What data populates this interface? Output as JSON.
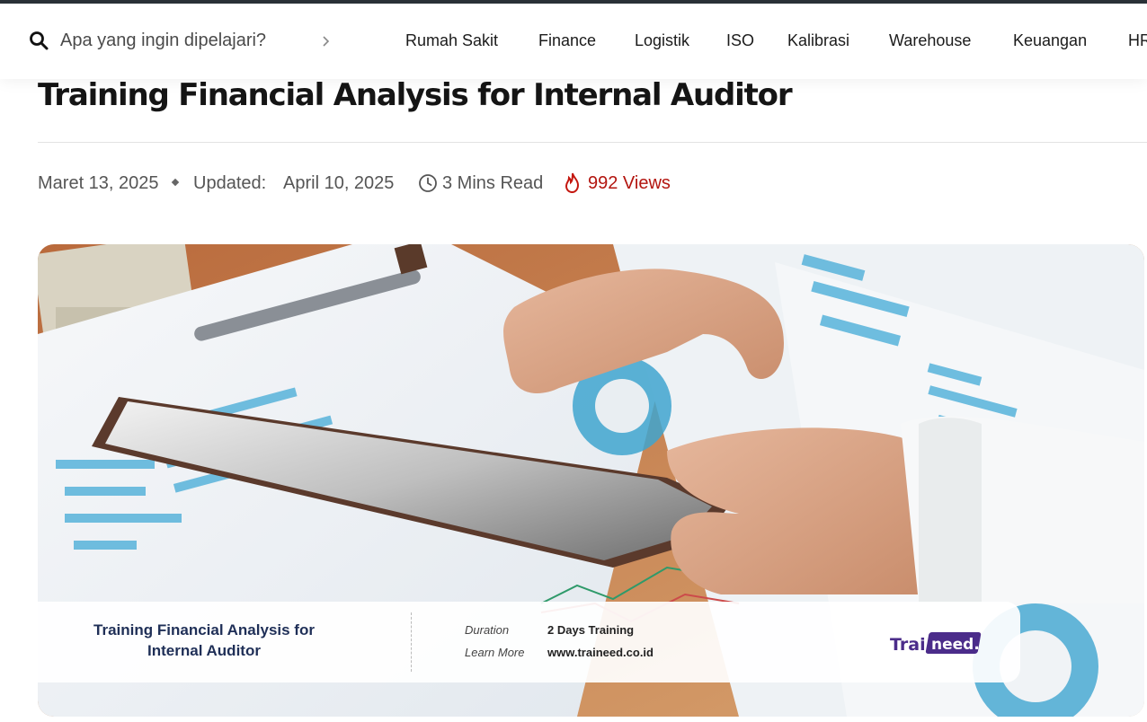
{
  "search": {
    "placeholder": "Apa yang ingin dipelajari?"
  },
  "nav": {
    "items": [
      {
        "label": "Rumah Sakit"
      },
      {
        "label": "Finance"
      },
      {
        "label": "Logistik"
      },
      {
        "label": "ISO"
      },
      {
        "label": "Kalibrasi"
      },
      {
        "label": "Warehouse"
      },
      {
        "label": "Keuangan"
      },
      {
        "label": "HR"
      }
    ]
  },
  "article": {
    "title": "Training Financial Analysis for Internal Auditor",
    "published": "Maret 13, 2025",
    "updated_label": "Updated:",
    "updated": "April 10, 2025",
    "read_time": "3 Mins Read",
    "views": "992 Views"
  },
  "hero": {
    "banner_title": "Training Financial Analysis for Internal Auditor",
    "duration_label": "Duration",
    "duration_value": "2 Days Training",
    "learn_label": "Learn More",
    "learn_value": "www.traineed.co.id",
    "logo_text": "Traineed."
  },
  "colors": {
    "accent": "#b3150f",
    "banner_title": "#1f2f57",
    "logo": "#4b2c8a"
  }
}
